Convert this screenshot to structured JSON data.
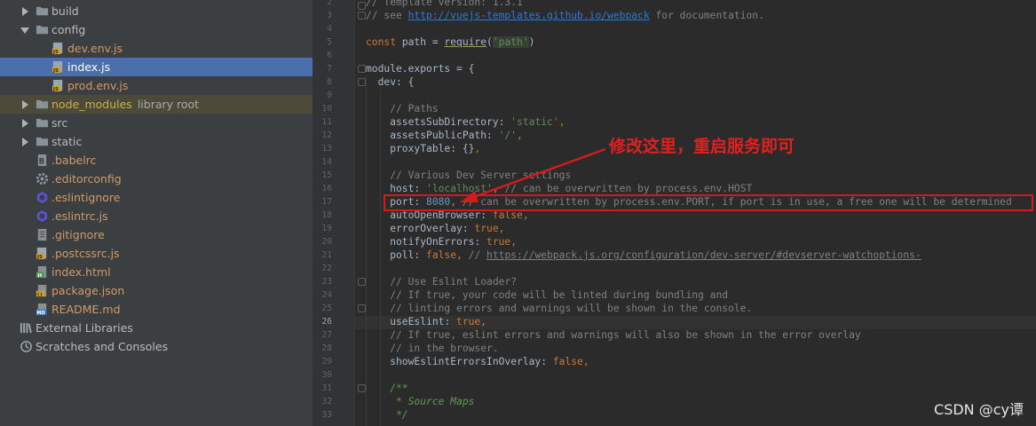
{
  "tree": {
    "items": [
      {
        "label": "build",
        "icon": "folder-icon"
      },
      {
        "label": "config",
        "icon": "folder-icon"
      },
      {
        "label": "dev.env.js",
        "icon": "js-file-icon"
      },
      {
        "label": "index.js",
        "icon": "js-file-icon"
      },
      {
        "label": "prod.env.js",
        "icon": "js-file-icon"
      },
      {
        "label": "node_modules",
        "suffix": "library root",
        "icon": "folder-icon"
      },
      {
        "label": "src",
        "icon": "folder-icon"
      },
      {
        "label": "static",
        "icon": "folder-icon"
      },
      {
        "label": ".babelrc",
        "icon": "babel-file-icon"
      },
      {
        "label": ".editorconfig",
        "icon": "gear-icon"
      },
      {
        "label": ".eslintignore",
        "icon": "eslint-icon"
      },
      {
        "label": ".eslintrc.js",
        "icon": "eslint-icon"
      },
      {
        "label": ".gitignore",
        "icon": "text-file-icon"
      },
      {
        "label": ".postcssrc.js",
        "icon": "js-file-icon"
      },
      {
        "label": "index.html",
        "icon": "html-file-icon"
      },
      {
        "label": "package.json",
        "icon": "json-file-icon"
      },
      {
        "label": "README.md",
        "icon": "markdown-file-icon"
      },
      {
        "label": "External Libraries",
        "icon": "libraries-icon"
      },
      {
        "label": "Scratches and Consoles",
        "icon": "scratches-icon"
      }
    ]
  },
  "editor": {
    "line_numbers": [
      "2",
      "3",
      "4",
      "5",
      "6",
      "7",
      "8",
      "9",
      "10",
      "11",
      "12",
      "13",
      "14",
      "15",
      "16",
      "17",
      "18",
      "19",
      "20",
      "21",
      "22",
      "23",
      "24",
      "25",
      "26",
      "27",
      "28",
      "29",
      "30",
      "31",
      "32",
      "33"
    ],
    "current_line": "26",
    "code": {
      "l2": "// Template version: 1.3.1",
      "l3a": "// see ",
      "l3b": "http://vuejs-templates.github.io/webpack",
      "l3c": " for documentation.",
      "l5a": "const ",
      "l5b": "path = ",
      "l5c": "require",
      "l5d": "(",
      "l5e": "'path'",
      "l5f": ")",
      "l7": "module.exports = {",
      "l8": "  dev: {",
      "l10": "    // Paths",
      "l11a": "    assetsSubDirectory: ",
      "l11b": "'static'",
      "l11c": ",",
      "l12a": "    assetsPublicPath: ",
      "l12b": "'/'",
      "l12c": ",",
      "l13a": "    proxyTable: {}",
      "l13b": ",",
      "l15": "    // Various Dev Server settings",
      "l16a": "    host: ",
      "l16b": "'localhost'",
      "l16c": ", ",
      "l16d": "// can be overwritten by process.env.HOST",
      "l17a": "    port: ",
      "l17b": "8080",
      "l17c": ", ",
      "l17d": "// can be overwritten by process.env.PORT, if port is in use, a free one will be determined",
      "l18a": "    autoOpenBrowser: ",
      "l18b": "false",
      "l18c": ",",
      "l19a": "    errorOverlay: ",
      "l19b": "true",
      "l19c": ",",
      "l20a": "    notifyOnErrors: ",
      "l20b": "true",
      "l20c": ",",
      "l21a": "    poll: ",
      "l21b": "false",
      "l21c": ", ",
      "l21d": "// ",
      "l21e": "https://webpack.js.org/configuration/dev-server/#devserver-watchoptions-",
      "l23": "    // Use Eslint Loader?",
      "l24": "    // If true, your code will be linted during bundling and",
      "l25": "    // linting errors and warnings will be shown in the console.",
      "l26a": "    useEslint: ",
      "l26b": "true",
      "l26c": ",",
      "l27": "    // If true, eslint errors and warnings will also be shown in the error overlay",
      "l28": "    // in the browser.",
      "l29a": "    showEslintErrorsInOverlay: ",
      "l29b": "false",
      "l29c": ",",
      "l31": "    /**",
      "l32": "     * Source Maps",
      "l33": "     */"
    }
  },
  "annotation": {
    "text": "修改这里，重启服务即可",
    "color": "#d21c1c"
  },
  "watermark": "CSDN @cy谭"
}
